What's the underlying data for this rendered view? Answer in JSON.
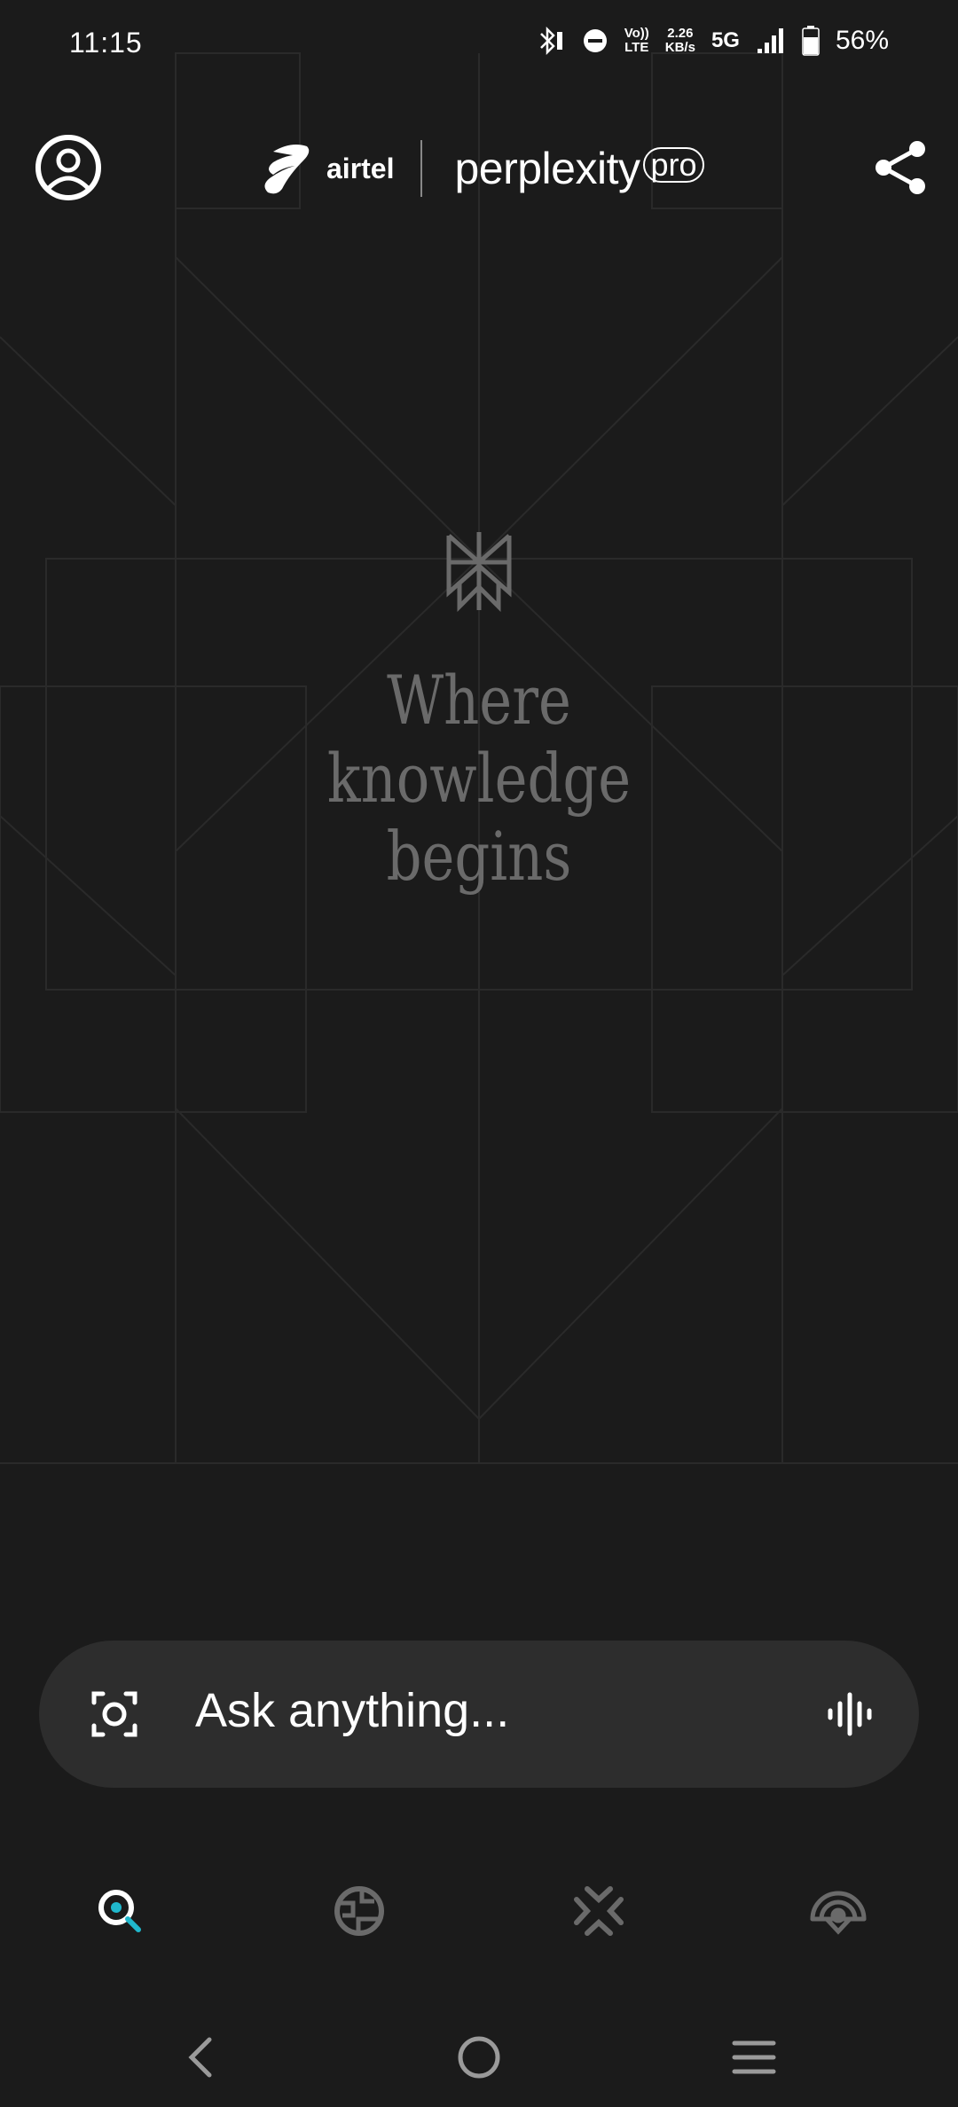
{
  "status_bar": {
    "time": "11:15",
    "volte_top": "Vo))",
    "volte_bottom": "LTE",
    "speed_value": "2.26",
    "speed_unit": "KB/s",
    "network": "5G",
    "battery": "56%"
  },
  "header": {
    "partner_name": "airtel",
    "app_name": "perplexity",
    "tier_badge": "pro"
  },
  "hero": {
    "tagline_line1": "Where",
    "tagline_line2": "knowledge",
    "tagline_line3": "begins"
  },
  "search": {
    "placeholder": "Ask anything..."
  },
  "colors": {
    "background": "#1b1b1b",
    "search_bar": "#2d2d2d",
    "accent": "#20b8cd",
    "tagline": "#6a6a6a"
  }
}
